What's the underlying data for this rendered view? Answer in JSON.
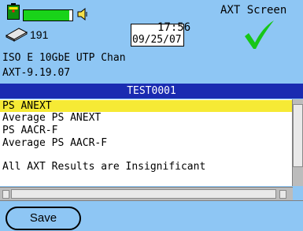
{
  "header": {
    "screen_title": "AXT Screen",
    "storage_count": "191",
    "time": "17:56",
    "date": "09/25/07",
    "battery_level": 0.94,
    "icons": {
      "battery": "battery-icon",
      "speaker": "speaker-icon",
      "storage": "storage-icon",
      "status": "checkmark-icon"
    },
    "colors": {
      "battery": "#19d319",
      "check": "#17c617"
    }
  },
  "info": {
    "line1": "ISO E 10GbE UTP Chan",
    "line2": "AXT-9.19.07"
  },
  "results": {
    "title": "TEST0001",
    "items": [
      "PS ANEXT",
      "Average PS ANEXT",
      "PS AACR-F",
      "Average PS AACR-F",
      "All AXT Results are Insignificant"
    ],
    "selected_index": 0,
    "colors": {
      "title_bar": "#1a2bb1",
      "selection": "#f6ea35"
    }
  },
  "footer": {
    "save_label": "Save"
  }
}
